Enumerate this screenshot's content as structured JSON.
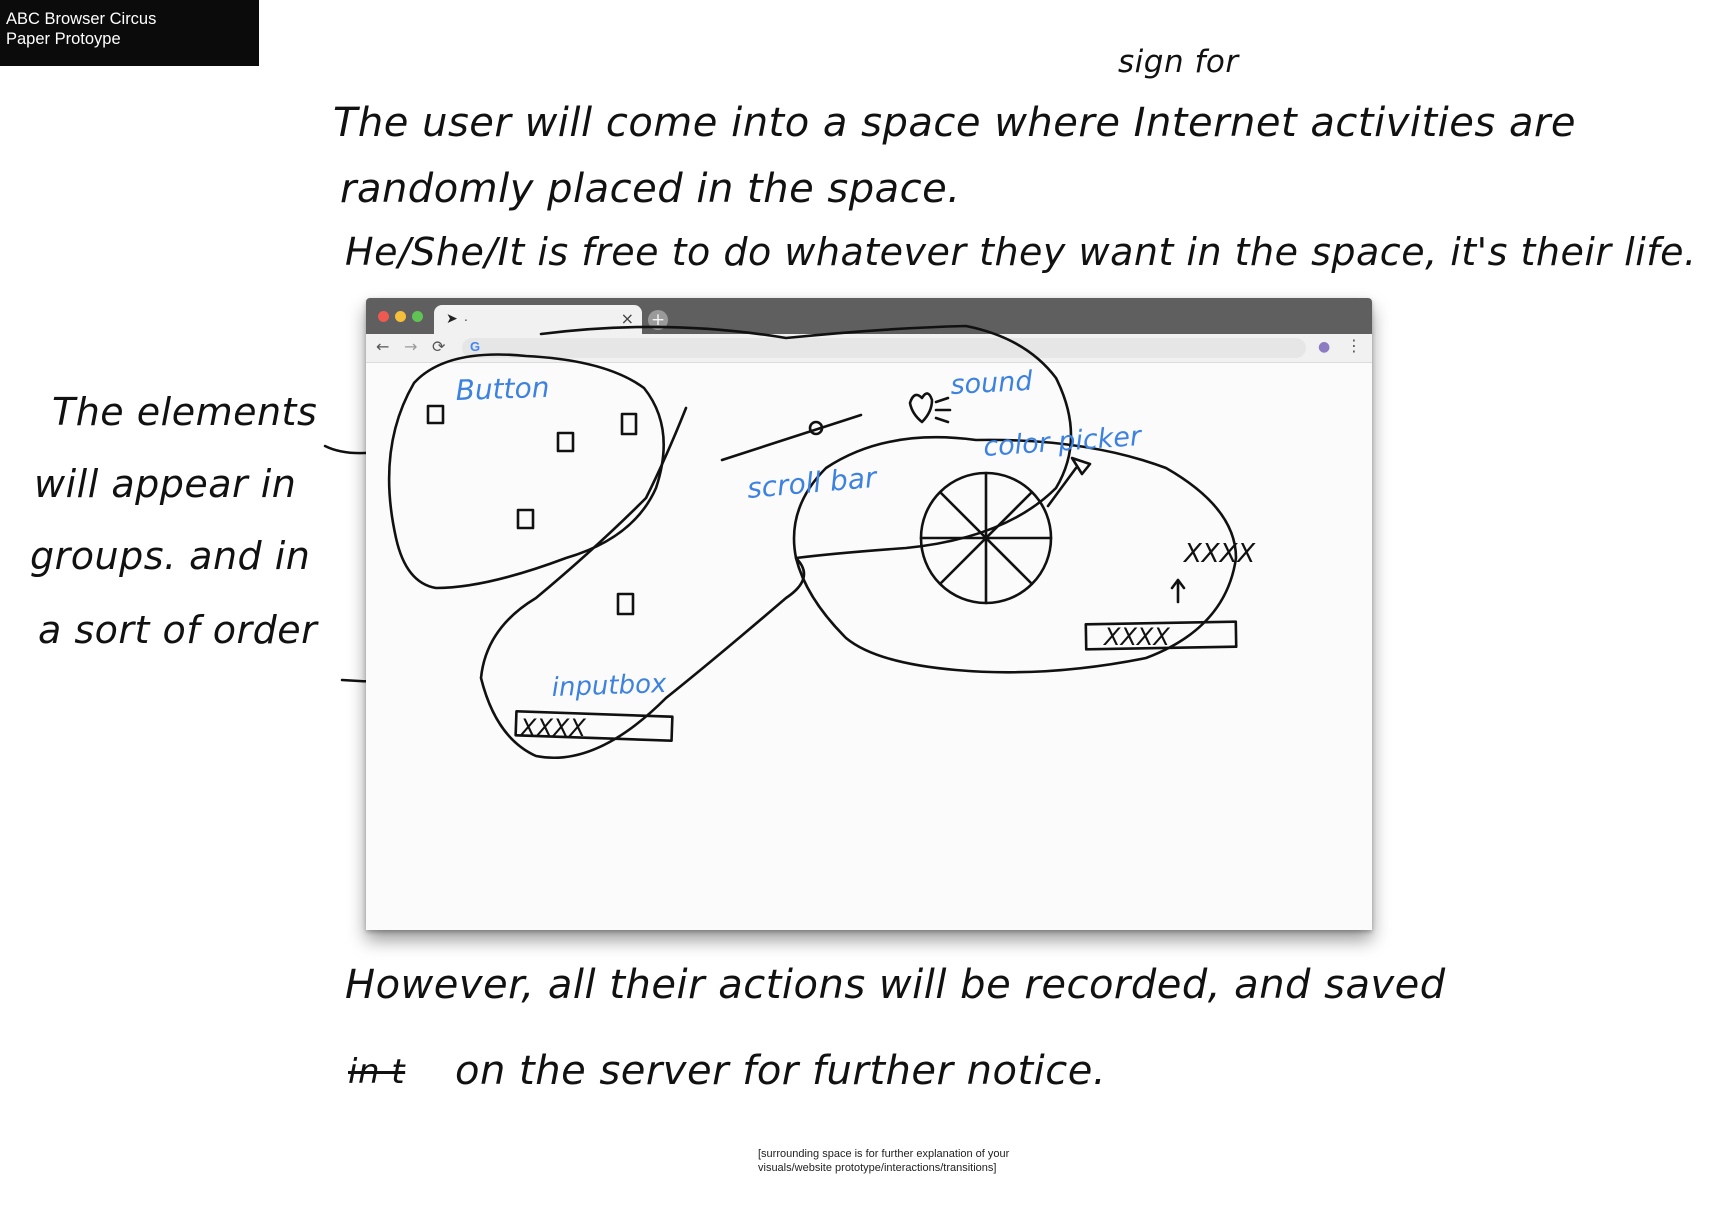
{
  "header": {
    "line1": "ABC Browser Circus",
    "line2": "Paper Protoype"
  },
  "notes": {
    "intro_line1": "The user will come into a space where Internet activities are",
    "intro_insert": "sign for",
    "intro_line2": "randomly placed in the space.",
    "intro_line3": "He/She/It is free to do whatever they want in the space, it's their life.",
    "side_line1": "The elements",
    "side_line2": "will appear in",
    "side_line3": "groups. and in",
    "side_line4": "a sort of order",
    "outro_line1": "However, all their actions will be recorded, and saved",
    "outro_struck": "in t",
    "outro_line2": "on the server for further notice."
  },
  "browser": {
    "tab_label": ".",
    "close_glyph": "×",
    "newtab_glyph": "+",
    "back_glyph": "←",
    "forward_glyph": "→",
    "reload_glyph": "⟳",
    "menu_glyph": "⋮",
    "g_glyph": "G",
    "icons": [
      "cursor-icon",
      "close-icon",
      "plus-icon",
      "back-arrow-icon",
      "forward-arrow-icon",
      "reload-icon",
      "google-icon",
      "extension-icon",
      "menu-dots-icon"
    ]
  },
  "sketch": {
    "labels": {
      "button": "Button",
      "sound": "sound",
      "scroll_bar": "scroll bar",
      "color_picker": "color picker",
      "inputbox": "inputbox",
      "inputbox_value": "XXXX",
      "output_text": "XXXX",
      "output_box_value": "XXXX"
    },
    "label_color": "#3d82e0",
    "ink_color": "#111111"
  },
  "caption": {
    "line1": "[surrounding space is for further explanation of your",
    "line2": "visuals/website prototype/interactions/transitions]"
  }
}
